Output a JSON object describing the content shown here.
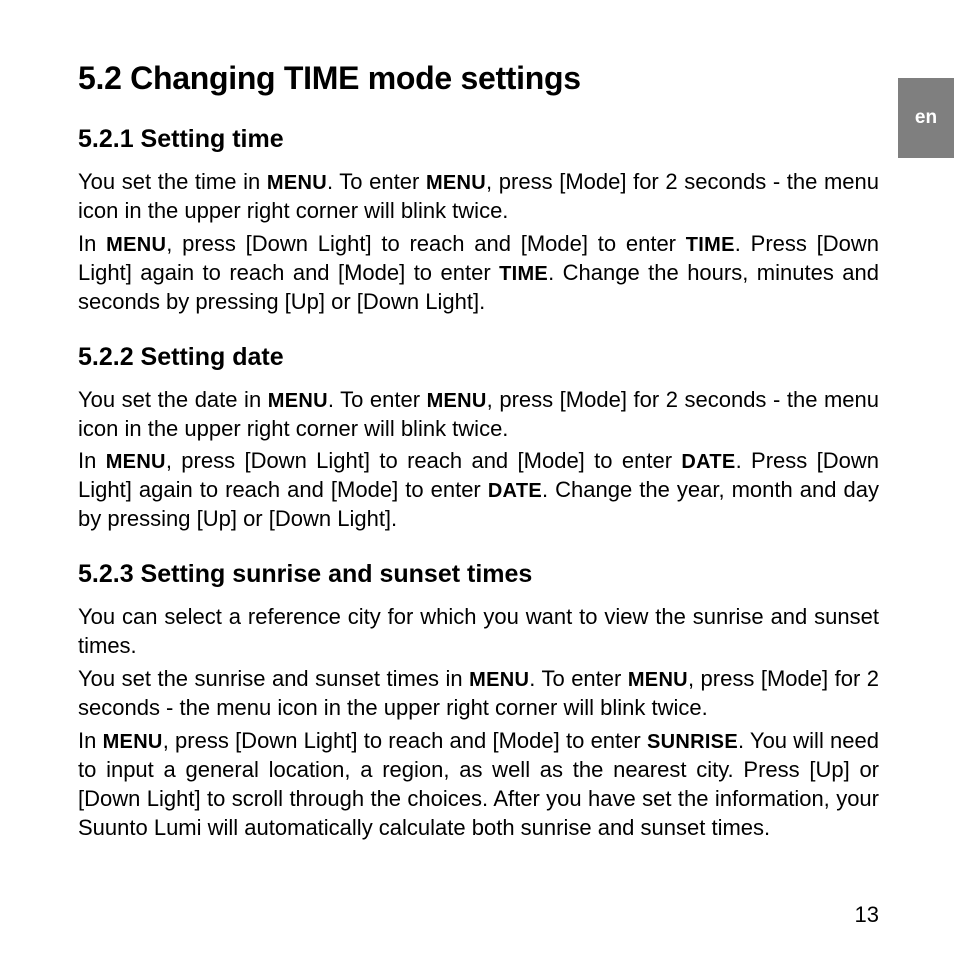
{
  "lang_tab": "en",
  "section_heading": "5.2  Changing TIME mode settings",
  "s1": {
    "heading": "5.2.1  Setting time",
    "p1a": "You set the time in ",
    "p1b": ". To enter ",
    "p1c": ", press [Mode] for 2 seconds - the menu icon in the upper right corner will blink twice.",
    "p2a": "In ",
    "p2b": ", press [Down Light] to reach and [Mode] to enter ",
    "p2c": ". Press [Down Light] again to reach and [Mode] to enter ",
    "p2d": ". Change the hours, minutes and seconds by pressing [Up] or [Down Light]."
  },
  "s2": {
    "heading": "5.2.2  Setting date",
    "p1a": "You set the date in ",
    "p1b": ". To enter ",
    "p1c": ", press [Mode] for 2 seconds - the menu icon in the upper right corner will blink twice.",
    "p2a": "In ",
    "p2b": ", press [Down Light] to reach and [Mode] to enter ",
    "p2c": ". Press [Down Light] again to reach and [Mode] to enter ",
    "p2d": ". Change the year, month and day by pressing [Up] or [Down Light]."
  },
  "s3": {
    "heading": "5.2.3  Setting sunrise and sunset times",
    "p1": "You can select a reference city for which you want to view the sunrise and sunset times.",
    "p2a": "You set the sunrise and sunset times in ",
    "p2b": ". To enter ",
    "p2c": ", press [Mode] for 2 seconds - the menu icon in the upper right corner will blink twice.",
    "p3a": "In ",
    "p3b": ", press [Down Light] to reach and [Mode] to enter ",
    "p3c": ". You will need to input a general location, a region, as well as the nearest city. Press [Up] or [Down Light] to scroll through the choices. After you have set the information, your Suunto Lumi will automatically calculate both sunrise and sunset times."
  },
  "terms": {
    "menu": "MENU",
    "time": "TIME",
    "date": "DATE",
    "sunrise": "SUNRISE"
  },
  "page_number": "13"
}
